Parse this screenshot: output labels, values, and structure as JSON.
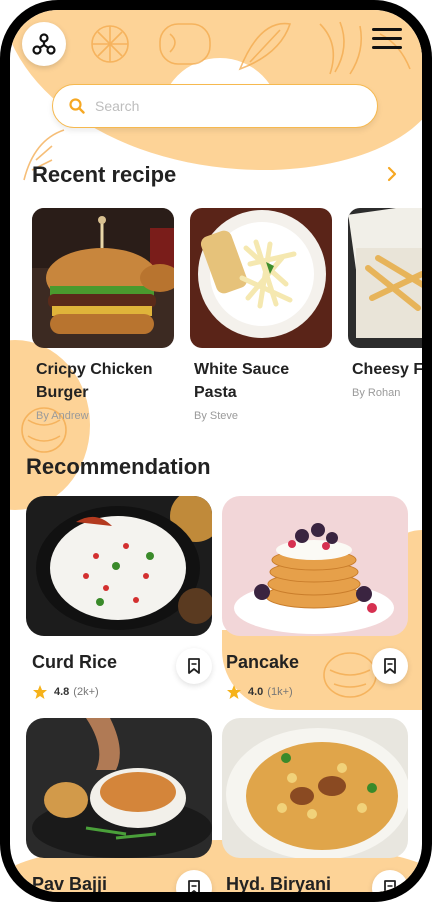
{
  "search": {
    "placeholder": "Search"
  },
  "recent": {
    "title": "Recent recipe",
    "items": [
      {
        "name": "Cricpy Chicken Burger",
        "author": "By Andrew"
      },
      {
        "name": "White Sauce Pasta",
        "author": "By Steve"
      },
      {
        "name": "Cheesy Fries",
        "author": "By  Rohan"
      }
    ]
  },
  "recommendation": {
    "title": "Recommendation",
    "items": [
      {
        "name": "Curd Rice",
        "rating": "4.8",
        "count": "(2k+)"
      },
      {
        "name": "Pancake",
        "rating": "4.0",
        "count": "(1k+)"
      },
      {
        "name": "Pav Bajji"
      },
      {
        "name": "Hyd. Biryani"
      }
    ]
  },
  "icons": {
    "logo": "triskelion-logo-icon",
    "menu": "hamburger-menu-icon",
    "search": "search-icon",
    "chevron": "chevron-right-icon",
    "star": "star-icon",
    "bookmark": "bookmark-icon"
  },
  "colors": {
    "accent": "#f6a823",
    "blob": "#fdd397",
    "star": "#f6b21a"
  }
}
